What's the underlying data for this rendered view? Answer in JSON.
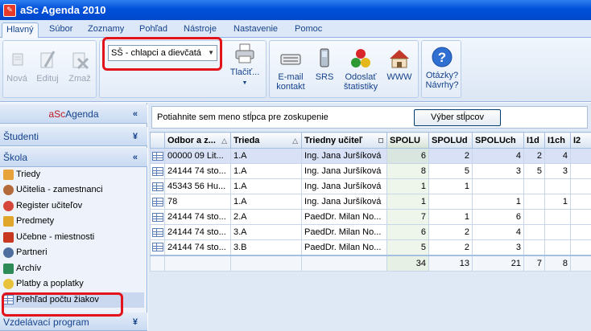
{
  "window": {
    "title": "aSc Agenda 2010"
  },
  "menu": {
    "tabs": [
      {
        "label": "Hlavný",
        "active": true
      },
      {
        "label": "Súbor"
      },
      {
        "label": "Zoznamy"
      },
      {
        "label": "Pohľad"
      },
      {
        "label": "Nástroje"
      },
      {
        "label": "Nastavenie"
      },
      {
        "label": "Pomoc"
      }
    ]
  },
  "ribbon": {
    "new_label": "Nová",
    "edit_label": "Edituj",
    "delete_label": "Zmaž",
    "selector_value": "SŠ - chlapci a dievčatá",
    "print_label": "Tlačiť...",
    "email_label_1": "E-mail",
    "email_label_2": "kontakt",
    "srs_label": "SRS",
    "send_stats_label_1": "Odoslať",
    "send_stats_label_2": "štatistiky",
    "www_label": "WWW",
    "help_label_1": "Otázky?",
    "help_label_2": "Návrhy?"
  },
  "sidebar": {
    "title_a": "aSc",
    "title_b": "Agenda",
    "sections": {
      "students": "Študenti",
      "school": "Škola",
      "program": "Vzdelávací program"
    },
    "items": [
      "Triedy",
      "Učitelia - zamestnanci",
      "Register učiteľov",
      "Predmety",
      "Učebne - miestnosti",
      "Partneri",
      "Archív",
      "Platby a poplatky",
      "Prehľad počtu žiakov"
    ]
  },
  "grid": {
    "group_hint": "Potiahnite sem meno stĺpca pre zoskupenie",
    "columns_button": "Výber stĺpcov",
    "headers": [
      "Odbor a z...",
      "Trieda",
      "Triedny učiteľ",
      "SPOLU",
      "SPOLUd",
      "SPOLUch",
      "I1d",
      "I1ch",
      "I2"
    ],
    "rows": [
      [
        "00000 09 Lit...",
        "1.A",
        "Ing. Jana Juršíková",
        "6",
        "2",
        "4",
        "2",
        "4",
        ""
      ],
      [
        "24144 74 sto...",
        "1.A",
        "Ing. Jana Juršíková",
        "8",
        "5",
        "3",
        "5",
        "3",
        ""
      ],
      [
        "45343 56 Hu...",
        "1.A",
        "Ing. Jana Juršíková",
        "1",
        "1",
        "",
        "",
        "",
        ""
      ],
      [
        "78",
        "1.A",
        "Ing. Jana Juršíková",
        "1",
        "",
        "1",
        "",
        "1",
        ""
      ],
      [
        "24144 74 sto...",
        "2.A",
        "PaedDr. Milan No...",
        "7",
        "1",
        "6",
        "",
        "",
        ""
      ],
      [
        "24144 74 sto...",
        "3.A",
        "PaedDr. Milan No...",
        "6",
        "2",
        "4",
        "",
        "",
        ""
      ],
      [
        "24144 74 sto...",
        "3.B",
        "PaedDr. Milan No...",
        "5",
        "2",
        "3",
        "",
        "",
        ""
      ]
    ],
    "totals": [
      "34",
      "13",
      "21",
      "7",
      "8",
      ""
    ]
  },
  "colors": {
    "highlight": "#e2131b",
    "accent": "#15428b"
  }
}
